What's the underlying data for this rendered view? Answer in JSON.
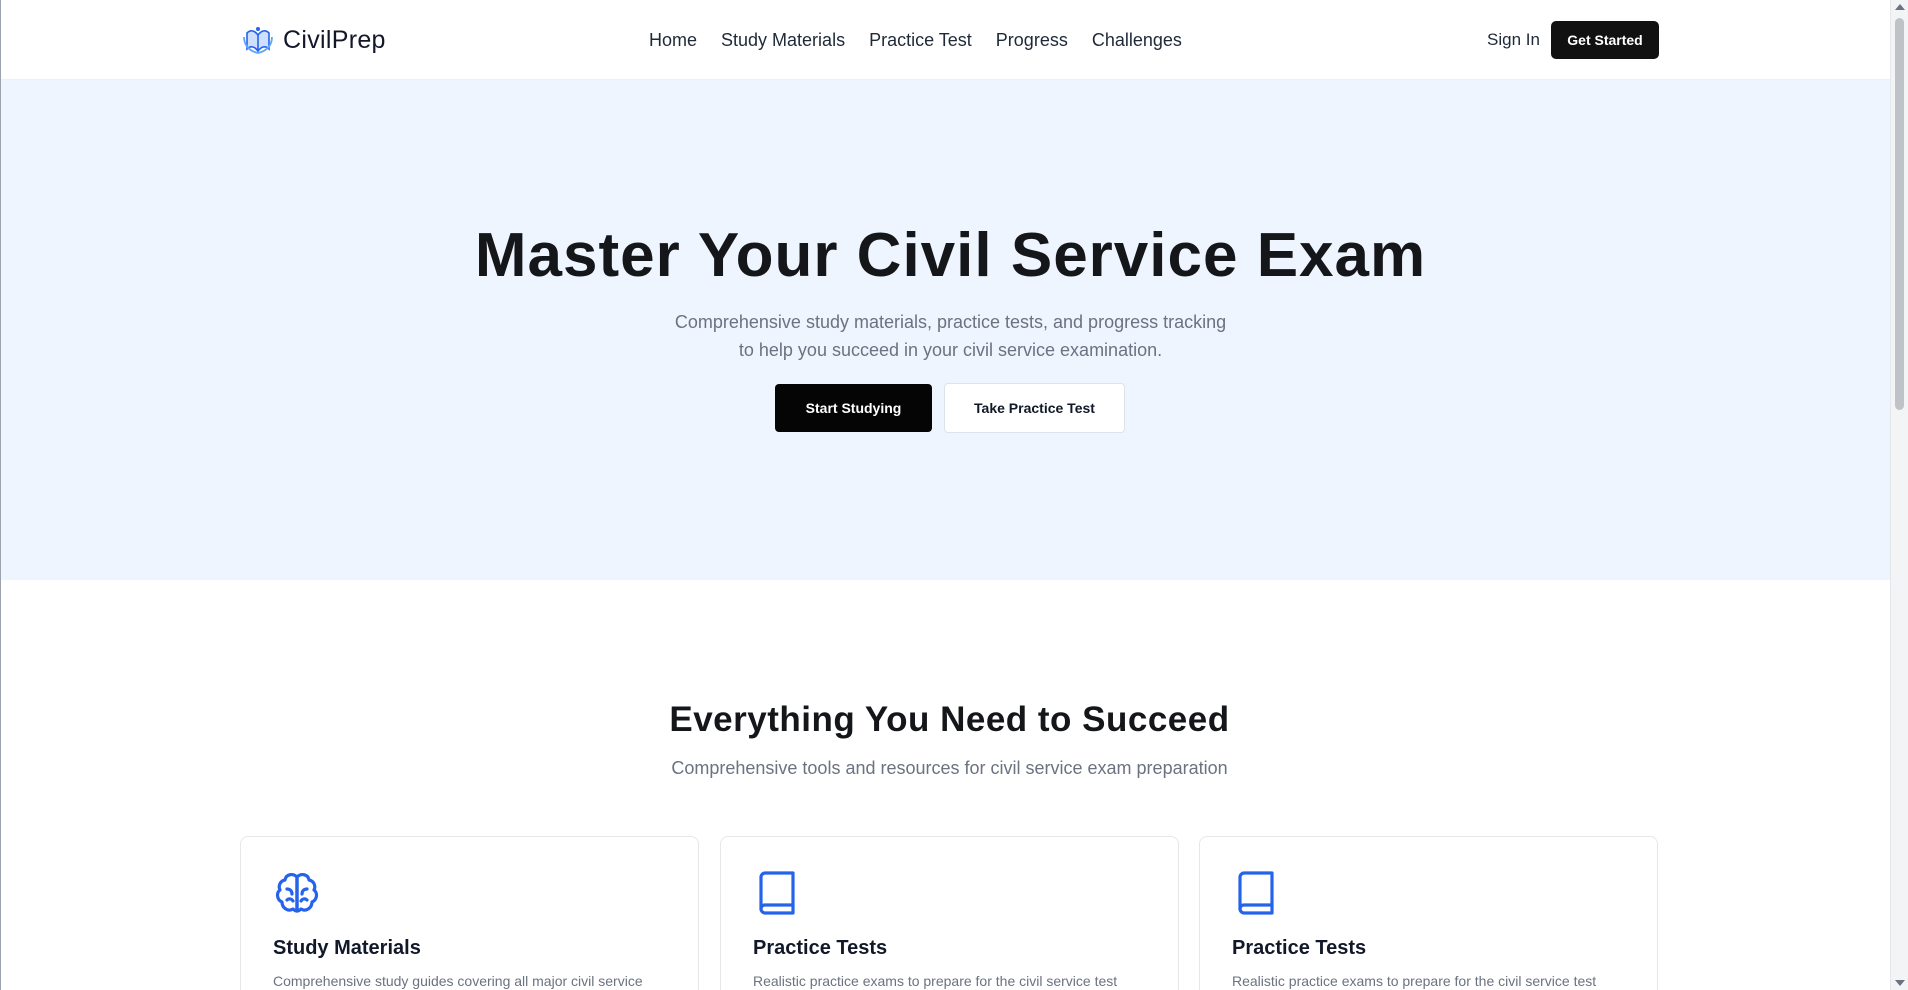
{
  "header": {
    "logo_text": "CivilPrep",
    "nav": [
      "Home",
      "Study Materials",
      "Practice Test",
      "Progress",
      "Challenges"
    ],
    "sign_in": "Sign In",
    "get_started": "Get Started"
  },
  "hero": {
    "title": "Master Your Civil Service Exam",
    "subtitle_line1": "Comprehensive study materials, practice tests, and progress tracking",
    "subtitle_line2": "to help you succeed in your civil service examination.",
    "primary_button": "Start Studying",
    "secondary_button": "Take Practice Test"
  },
  "features": {
    "title": "Everything You Need to Succeed",
    "subtitle": "Comprehensive tools and resources for civil service exam preparation",
    "cards": [
      {
        "icon": "brain-icon",
        "title": "Study Materials",
        "desc": "Comprehensive study guides covering all major civil service"
      },
      {
        "icon": "book-icon",
        "title": "Practice Tests",
        "desc": "Realistic practice exams to prepare for the civil service test"
      },
      {
        "icon": "book-icon",
        "title": "Practice Tests",
        "desc": "Realistic practice exams to prepare for the civil service test"
      }
    ]
  },
  "colors": {
    "accent": "#2563eb",
    "hero_bg": "#eef5ff",
    "primary_button": "#050505"
  }
}
